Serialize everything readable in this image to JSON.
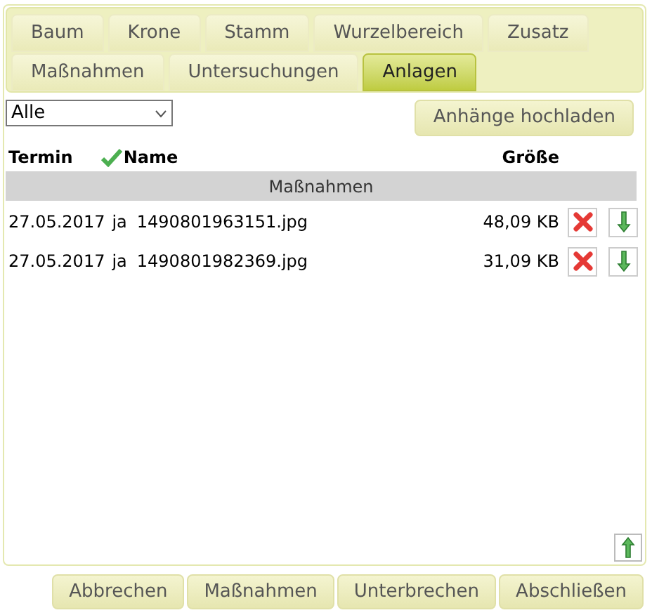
{
  "tabs": [
    [
      {
        "label": "Baum",
        "selected": false
      },
      {
        "label": "Krone",
        "selected": false
      },
      {
        "label": "Stamm",
        "selected": false
      },
      {
        "label": "Wurzelbereich",
        "selected": false
      },
      {
        "label": "Zusatz",
        "selected": false
      }
    ],
    [
      {
        "label": "Maßnahmen",
        "selected": false
      },
      {
        "label": "Untersuchungen",
        "selected": false
      },
      {
        "label": "Anlagen",
        "selected": true
      }
    ]
  ],
  "filter": {
    "value": "Alle"
  },
  "upload_button": "Anhänge hochladen",
  "table": {
    "columns": [
      "Termin",
      "Name",
      "Größe"
    ],
    "groups": [
      {
        "title": "Maßnahmen",
        "rows": [
          {
            "termin": "27.05.2017",
            "flag": "ja",
            "name": "1490801963151.jpg",
            "size": "48,09 KB"
          },
          {
            "termin": "27.05.2017",
            "flag": "ja",
            "name": "1490801982369.jpg",
            "size": "31,09 KB"
          }
        ]
      }
    ]
  },
  "footer_buttons": [
    "Abbrechen",
    "Maßnahmen",
    "Unterbrechen",
    "Abschließen"
  ]
}
